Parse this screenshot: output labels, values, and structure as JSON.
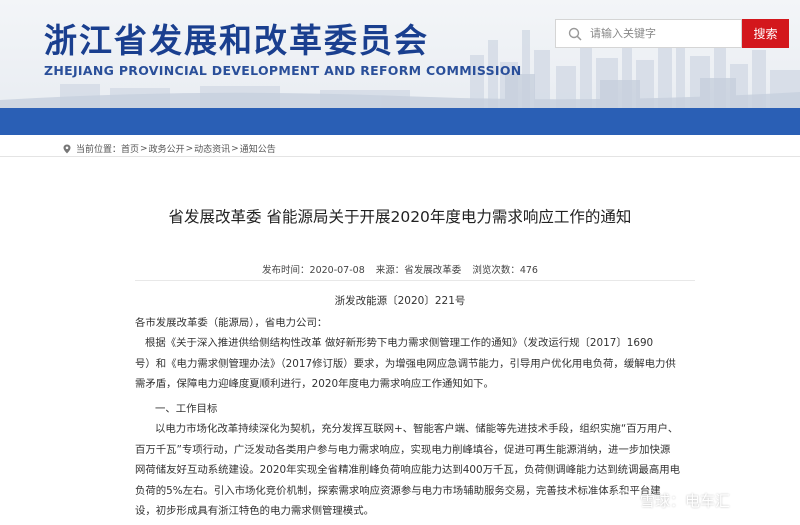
{
  "header": {
    "title_cn": "浙江省发展和改革委员会",
    "title_en": "ZHEJIANG PROVINCIAL DEVELOPMENT AND REFORM COMMISSION",
    "search_placeholder": "请输入关键字",
    "search_button": "搜索"
  },
  "breadcrumb": {
    "prefix": "当前位置：",
    "items": [
      "首页",
      "政务公开",
      "动态资讯",
      "通知公告"
    ],
    "separator": ">"
  },
  "article": {
    "title": "省发展改革委 省能源局关于开展2020年度电力需求响应工作的通知",
    "meta": {
      "date": "发布时间：2020-07-08",
      "source": "来源：省发展改革委",
      "views": "浏览次数：476"
    },
    "doc_number": "浙发改能源〔2020〕221号",
    "addressee": "各市发展改革委（能源局），省电力公司：",
    "para1_lines": [
      "根据《关于深入推进供给侧结构性改革 做好新形势下电力需求侧管理工作的通知》（发改运行规〔2017〕1690",
      "号）和《电力需求侧管理办法》（2017修订版）要求，为增强电网应急调节能力，引导用户优化用电负荷，缓解电力供",
      "需矛盾，保障电力迎峰度夏顺利进行，2020年度电力需求响应工作通知如下。"
    ],
    "heading1": "一、工作目标",
    "para2_lines": [
      "以电力市场化改革持续深化为契机，充分发挥互联网+、智能客户端、储能等先进技术手段，组织实施“百万用户、",
      "百万千瓦”专项行动，广泛发动各类用户参与电力需求响应，实现电力削峰填谷，促进可再生能源消纳，进一步加快源",
      "网荷储友好互动系统建设。2020年实现全省精准削峰负荷响应能力达到400万千瓦，负荷侧调峰能力达到统调最高用电",
      "负荷的5%左右。引入市场化竞价机制，探索需求响应资源参与电力市场辅助服务交易，完善技术标准体系和平台建",
      "设，初步形成具有浙江特色的电力需求侧管理模式。"
    ]
  },
  "watermark": {
    "text": "雪球：电车汇"
  },
  "colors": {
    "brand_blue": "#1a3f8f",
    "nav_blue": "#2a5fb5",
    "search_red": "#d3171c"
  }
}
